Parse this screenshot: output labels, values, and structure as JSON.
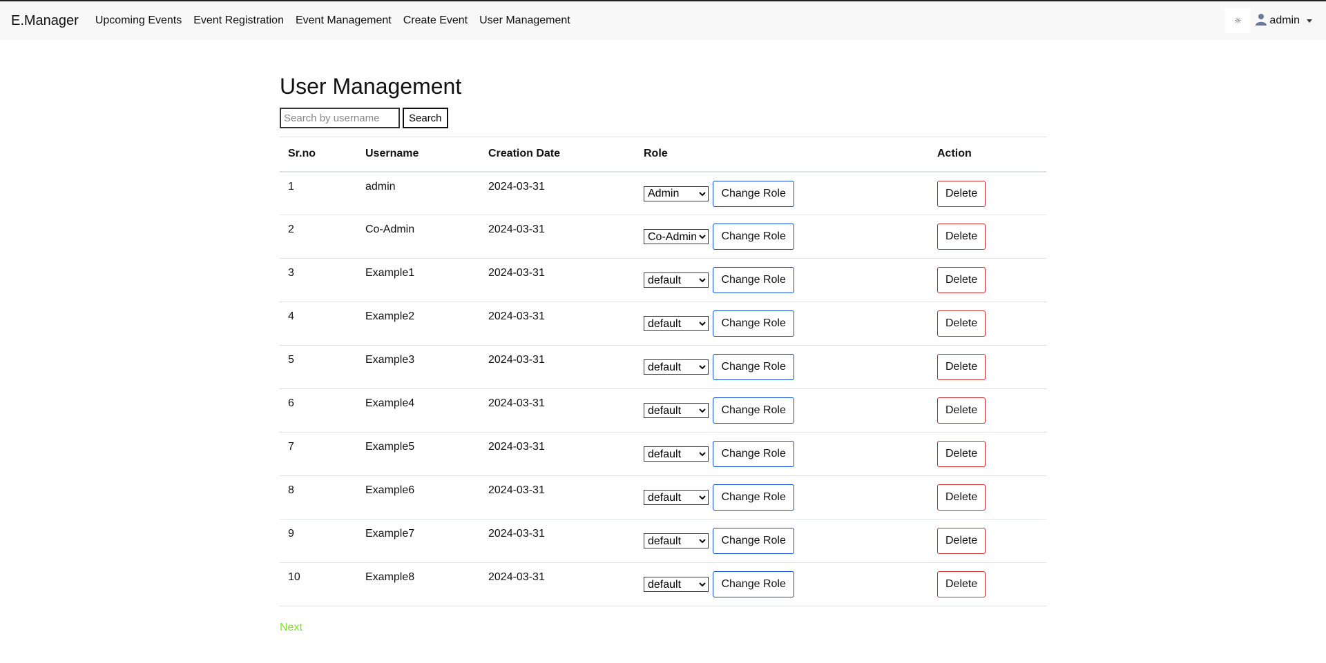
{
  "navbar": {
    "brand": "E.Manager",
    "links": [
      "Upcoming Events",
      "Event Registration",
      "Event Management",
      "Create Event",
      "User Management"
    ],
    "theme_toggle_icon": "sun-icon",
    "theme_toggle_glyph": "☼",
    "user_icon": "user-avatar-icon",
    "user_name": "admin"
  },
  "page": {
    "title": "User Management",
    "search_placeholder": "Search by username",
    "search_value": "",
    "search_button": "Search"
  },
  "table": {
    "headers": [
      "Sr.no",
      "Username",
      "Creation Date",
      "Role",
      "Action"
    ],
    "change_role_label": "Change Role",
    "delete_label": "Delete",
    "rows": [
      {
        "srno": "1",
        "username": "admin",
        "date": "2024-03-31",
        "role": "Admin"
      },
      {
        "srno": "2",
        "username": "Co-Admin",
        "date": "2024-03-31",
        "role": "Co-Admin"
      },
      {
        "srno": "3",
        "username": "Example1",
        "date": "2024-03-31",
        "role": "default"
      },
      {
        "srno": "4",
        "username": "Example2",
        "date": "2024-03-31",
        "role": "default"
      },
      {
        "srno": "5",
        "username": "Example3",
        "date": "2024-03-31",
        "role": "default"
      },
      {
        "srno": "6",
        "username": "Example4",
        "date": "2024-03-31",
        "role": "default"
      },
      {
        "srno": "7",
        "username": "Example5",
        "date": "2024-03-31",
        "role": "default"
      },
      {
        "srno": "8",
        "username": "Example6",
        "date": "2024-03-31",
        "role": "default"
      },
      {
        "srno": "9",
        "username": "Example7",
        "date": "2024-03-31",
        "role": "default"
      },
      {
        "srno": "10",
        "username": "Example8",
        "date": "2024-03-31",
        "role": "default"
      }
    ]
  },
  "pagination": {
    "next_label": "Next"
  },
  "colors": {
    "navbar_bg": "#f8f8f8",
    "change_role_border": "#0d47d9",
    "delete_border": "#c62828",
    "next_link": "#7fe329"
  }
}
